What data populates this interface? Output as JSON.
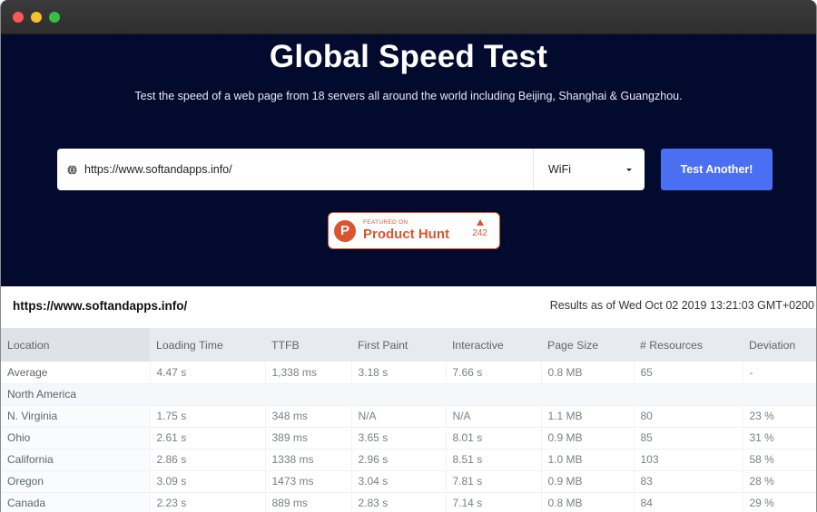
{
  "window": {
    "controls": [
      "close",
      "minimize",
      "maximize"
    ]
  },
  "hero": {
    "title": "Global Speed Test",
    "subtitle": "Test the speed of a web page from 18 servers all around the world including Beijing, Shanghai & Guangzhou.",
    "url_input": {
      "icon": "globe-icon",
      "value": "https://www.softandapps.info/"
    },
    "connection_select": {
      "selected": "WiFi"
    },
    "test_button_label": "Test Another!",
    "accent_color": "#4a6ff2",
    "background_color": "#020b2e"
  },
  "product_hunt": {
    "logo_letter": "P",
    "featured_label": "FEATURED ON",
    "name": "Product Hunt",
    "votes": "242",
    "color": "#da552f"
  },
  "results": {
    "url": "https://www.softandapps.info/",
    "timestamp": "Results as of Wed Oct 02 2019 13:21:03 GMT+0200",
    "columns": [
      "Location",
      "Loading Time",
      "TTFB",
      "First Paint",
      "Interactive",
      "Page Size",
      "# Resources",
      "Deviation"
    ],
    "average": [
      "Average",
      "4.47 s",
      "1,338 ms",
      "3.18 s",
      "7.66 s",
      "0.8 MB",
      "65",
      "-"
    ],
    "groups": [
      {
        "name": "North America",
        "rows": [
          [
            "N. Virginia",
            "1.75 s",
            "348 ms",
            "N/A",
            "N/A",
            "1.1 MB",
            "80",
            "23 %"
          ],
          [
            "Ohio",
            "2.61 s",
            "389 ms",
            "3.65 s",
            "8.01 s",
            "0.9 MB",
            "85",
            "31 %"
          ],
          [
            "California",
            "2.86 s",
            "1338 ms",
            "2.96 s",
            "8.51 s",
            "1.0 MB",
            "103",
            "58 %"
          ],
          [
            "Oregon",
            "3.09 s",
            "1473 ms",
            "3.04 s",
            "7.81 s",
            "0.9 MB",
            "83",
            "28 %"
          ],
          [
            "Canada",
            "2.23 s",
            "889 ms",
            "2.83 s",
            "7.14 s",
            "0.8 MB",
            "84",
            "29 %"
          ]
        ]
      }
    ]
  }
}
